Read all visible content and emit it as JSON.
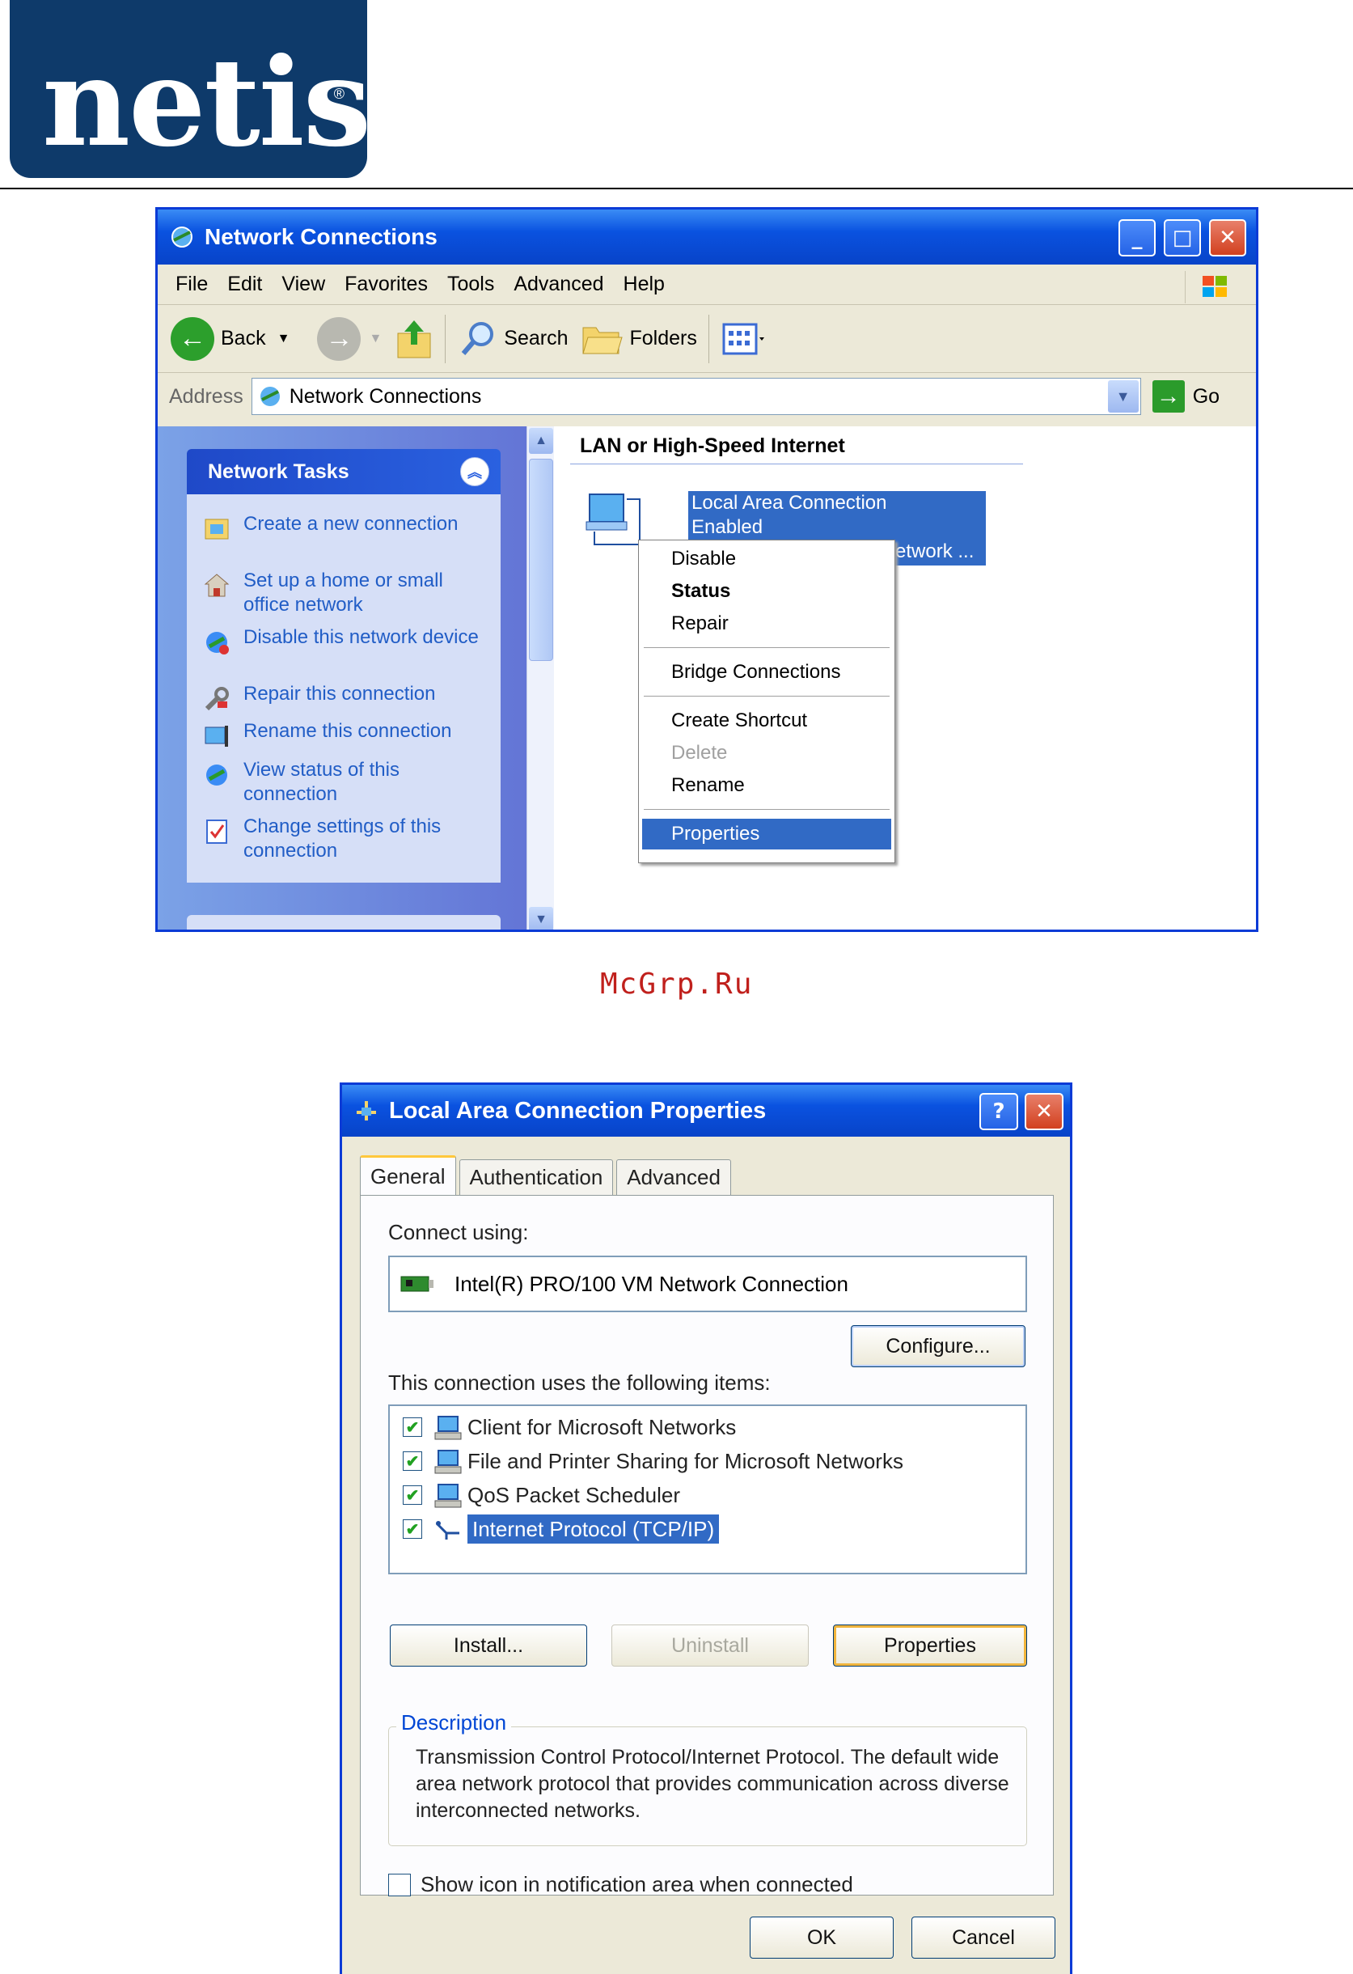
{
  "brand": {
    "logo_text": "netis",
    "reg_mark": "®"
  },
  "watermark": "McGrp.Ru",
  "network_window": {
    "title": "Network Connections",
    "menu": [
      "File",
      "Edit",
      "View",
      "Favorites",
      "Tools",
      "Advanced",
      "Help"
    ],
    "toolbar": {
      "back": "Back",
      "search": "Search",
      "folders": "Folders"
    },
    "address": {
      "label": "Address",
      "value": "Network Connections",
      "go": "Go"
    },
    "tasks": {
      "header": "Network Tasks",
      "items": [
        {
          "label": "Create a new connection",
          "icon": "new-connection-icon"
        },
        {
          "label": "Set up a home or small office network",
          "icon": "home-network-icon"
        },
        {
          "label": "Disable this network device",
          "icon": "disable-device-icon"
        },
        {
          "label": "Repair this connection",
          "icon": "repair-icon"
        },
        {
          "label": "Rename this connection",
          "icon": "rename-icon"
        },
        {
          "label": "View status of this connection",
          "icon": "status-icon"
        },
        {
          "label": "Change settings of this connection",
          "icon": "settings-icon"
        }
      ]
    },
    "section_title": "LAN or High-Speed Internet",
    "connection": {
      "name": "Local Area Connection",
      "status": "Enabled",
      "device_fragment": "etwork ..."
    },
    "context_menu": {
      "disable": "Disable",
      "status": "Status",
      "repair": "Repair",
      "bridge": "Bridge Connections",
      "shortcut": "Create Shortcut",
      "delete": "Delete",
      "rename": "Rename",
      "properties": "Properties"
    }
  },
  "properties_dialog": {
    "title": "Local Area Connection Properties",
    "help_btn": "?",
    "tabs": [
      "General",
      "Authentication",
      "Advanced"
    ],
    "connect_using_label": "Connect using:",
    "adapter": "Intel(R) PRO/100 VM Network Connection",
    "configure_btn": "Configure...",
    "items_label": "This connection uses the following items:",
    "items": [
      {
        "label": "Client for Microsoft Networks",
        "checked": true
      },
      {
        "label": "File and Printer Sharing for Microsoft Networks",
        "checked": true
      },
      {
        "label": "QoS Packet Scheduler",
        "checked": true
      },
      {
        "label": "Internet Protocol (TCP/IP)",
        "checked": true,
        "selected": true
      }
    ],
    "install_btn": "Install...",
    "uninstall_btn": "Uninstall",
    "properties_btn": "Properties",
    "description_title": "Description",
    "description_text": "Transmission Control Protocol/Internet Protocol. The default wide area network protocol that provides communication across diverse interconnected networks.",
    "show_icon_label": "Show icon in notification area when connected",
    "ok_btn": "OK",
    "cancel_btn": "Cancel"
  }
}
